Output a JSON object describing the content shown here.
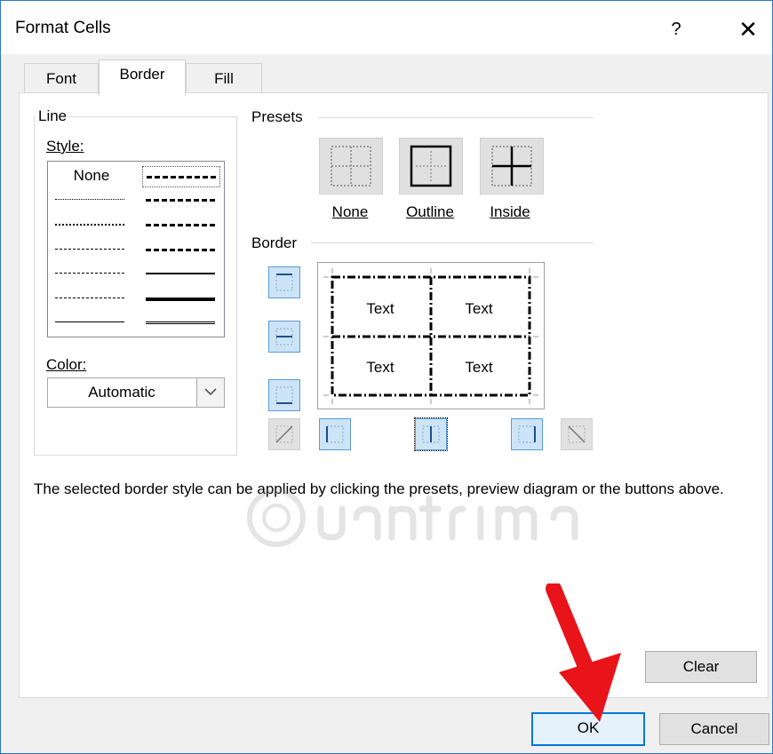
{
  "window": {
    "title": "Format Cells",
    "help_label": "?",
    "close_label": "✕"
  },
  "tabs": [
    {
      "label": "Font"
    },
    {
      "label": "Border"
    },
    {
      "label": "Fill"
    }
  ],
  "line_group": {
    "label": "Line",
    "style_label": "Style:",
    "none_option": "None",
    "color_label": "Color:",
    "color_value": "Automatic"
  },
  "presets": {
    "label": "Presets",
    "items": [
      {
        "label": "None"
      },
      {
        "label": "Outline"
      },
      {
        "label": "Inside"
      }
    ]
  },
  "border_group": {
    "label": "Border",
    "preview_cells": [
      "Text",
      "Text",
      "Text",
      "Text"
    ]
  },
  "description": "The selected border style can be applied by clicking the presets, preview diagram or the buttons above.",
  "buttons": {
    "clear": "Clear",
    "ok": "OK",
    "cancel": "Cancel"
  },
  "colors": {
    "accent": "#0078d7",
    "selected_border_button": "#cde4f7",
    "arrow": "#e8141a"
  }
}
